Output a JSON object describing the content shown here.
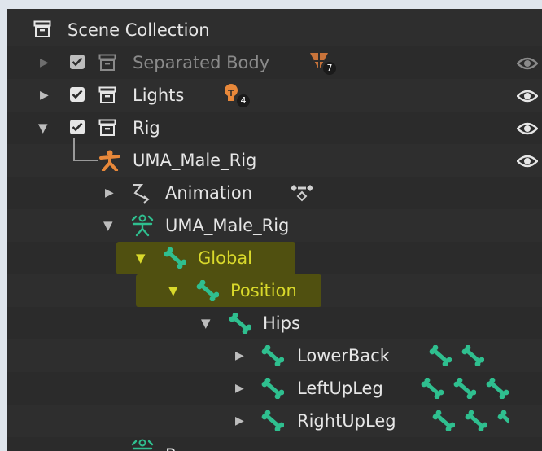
{
  "outliner": {
    "root_label": "Scene Collection",
    "rows": [
      {
        "label": "Separated Body",
        "badge_count": "7"
      },
      {
        "label": "Lights",
        "badge_count": "4"
      },
      {
        "label": "Rig"
      },
      {
        "label": "UMA_Male_Rig"
      },
      {
        "label": "Animation"
      },
      {
        "label": "UMA_Male_Rig"
      },
      {
        "label": "Global"
      },
      {
        "label": "Position"
      },
      {
        "label": "Hips"
      },
      {
        "label": "LowerBack"
      },
      {
        "label": "LeftUpLeg"
      },
      {
        "label": "RightUpLeg"
      }
    ],
    "bottom_partial_label": "P"
  },
  "colors": {
    "panel_bg": "#2e2e2e",
    "highlight": "#505010",
    "selected_text": "#d9d92b",
    "bone_green": "#2fbf8f",
    "armature_orange": "#e8883a"
  }
}
